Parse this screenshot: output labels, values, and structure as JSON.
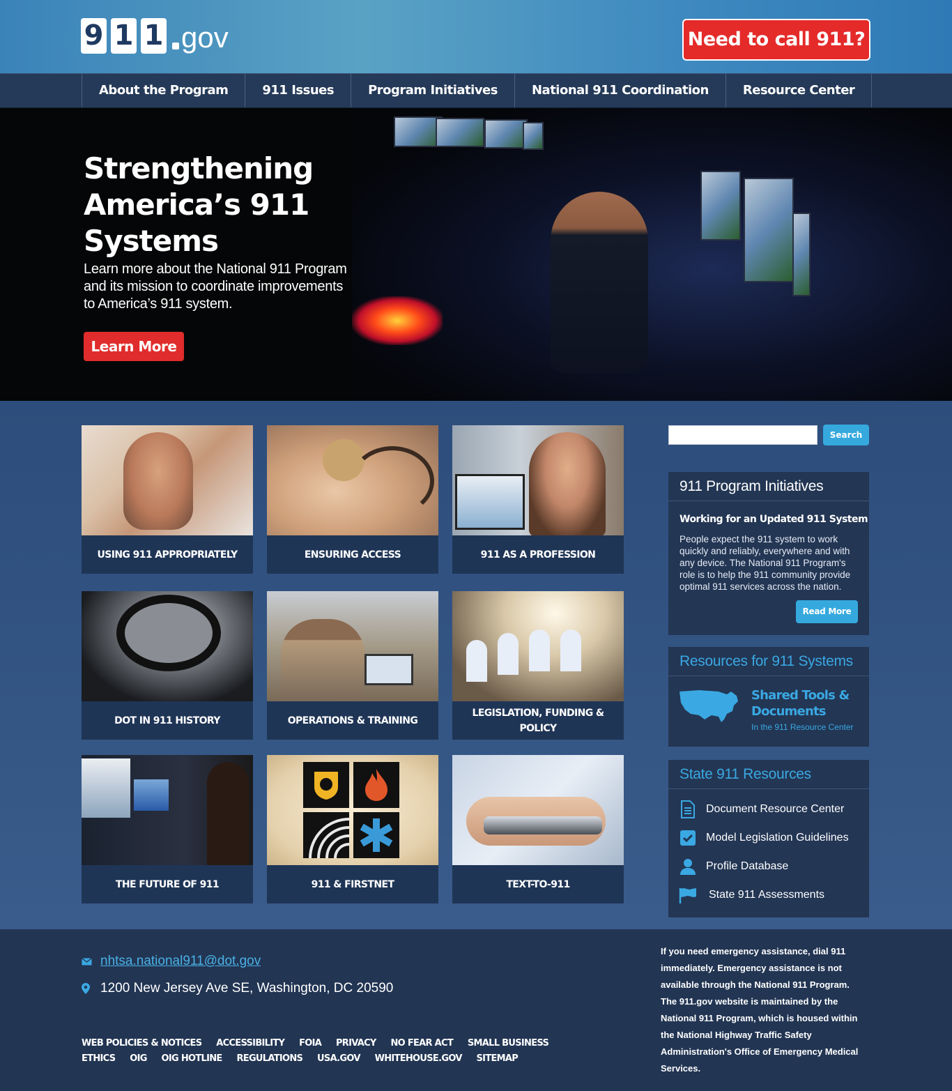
{
  "header": {
    "logo_digits": [
      "9",
      "1",
      "1"
    ],
    "logo_suffix": "gov",
    "call_button": "Need to call 911?"
  },
  "nav": {
    "items": [
      "About the Program",
      "911 Issues",
      "Program Initiatives",
      "National 911 Coordination",
      "Resource Center"
    ]
  },
  "hero": {
    "title": "Strengthening America’s 911 Systems",
    "text": "Learn more about the National 911 Program and its mission to coordinate improvements to America’s 911 system.",
    "button": "Learn More"
  },
  "tiles": [
    {
      "label": "USING 911 APPROPRIATELY"
    },
    {
      "label": "ENSURING ACCESS"
    },
    {
      "label": "911 AS A PROFESSION"
    },
    {
      "label": "DOT IN 911 HISTORY"
    },
    {
      "label": "OPERATIONS & TRAINING"
    },
    {
      "label": "LEGISLATION, FUNDING & POLICY"
    },
    {
      "label": "THE FUTURE OF 911"
    },
    {
      "label": "911 & FIRSTNET"
    },
    {
      "label": "TEXT-TO-911"
    }
  ],
  "search": {
    "placeholder": "",
    "button": "Search"
  },
  "initiatives": {
    "title": "911 Program Initiatives",
    "subtitle": "Working for an Updated 911 System",
    "body": "People expect the 911 system to work quickly and reliably, everywhere and with any device. The National 911 Program's role is to help the 911 community provide optimal 911 services across the nation.",
    "button": "Read More"
  },
  "resources": {
    "title": "Resources for 911 Systems",
    "link_title": "Shared Tools & Documents",
    "link_sub": "In the 911 Resource Center",
    "accent": "#3aa8e2"
  },
  "state": {
    "title": "State 911 Resources",
    "items": [
      {
        "label": "Document Resource Center",
        "icon": "document-icon"
      },
      {
        "label": "Model Legislation Guidelines",
        "icon": "checkbox-icon"
      },
      {
        "label": "Profile Database",
        "icon": "person-icon"
      },
      {
        "label": "State 911 Assessments",
        "icon": "flag-icon"
      }
    ]
  },
  "footer": {
    "email": "nhtsa.national911@dot.gov",
    "address": "1200 New Jersey Ave SE, Washington, DC 20590",
    "links": [
      "WEB POLICIES & NOTICES",
      "ACCESSIBILITY",
      "FOIA",
      "PRIVACY",
      "NO FEAR ACT",
      "SMALL BUSINESS",
      "ETHICS",
      "OIG",
      "OIG HOTLINE",
      "REGULATIONS",
      "USA.GOV",
      "WHITEHOUSE.GOV",
      "SITEMAP"
    ],
    "note": "If you need emergency assistance, dial 911 immediately. Emergency assistance is not available through the National 911 Program. The 911.gov website is maintained by the National 911 Program, which is housed within the National Highway Traffic Safety Administration's Office of Emergency Medical Services."
  },
  "colors": {
    "alert_red": "#e52a2a",
    "accent_blue": "#35a9de",
    "panel_bg": "#233654"
  }
}
